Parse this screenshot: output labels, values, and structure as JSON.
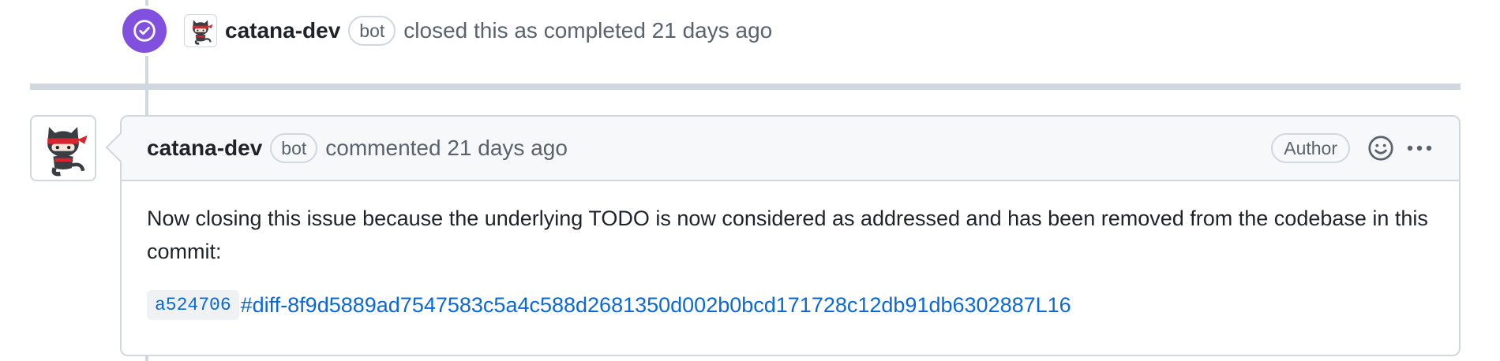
{
  "closed_event": {
    "author": "catana-dev",
    "bot_label": "bot",
    "text": "closed this as completed 21 days ago",
    "badge_icon": "check-circle-icon",
    "badge_color": "#8250df"
  },
  "comment": {
    "author": "catana-dev",
    "bot_label": "bot",
    "meta": "commented 21 days ago",
    "author_label": "Author",
    "reaction_icon": "smiley-icon",
    "more_icon": "kebab-horizontal-icon",
    "body": "Now closing this issue because the underlying TODO is now considered as addressed and has been removed from the codebase in this commit:",
    "commit_sha": "a524706",
    "commit_anchor": "#diff-8f9d5889ad7547583c5a4c588d2681350d002b0bcd171728c12db91db6302887L16"
  },
  "colors": {
    "link": "#0969da",
    "muted_text": "#59636e",
    "border": "#d0d7de",
    "header_bg": "#f6f8fa"
  }
}
